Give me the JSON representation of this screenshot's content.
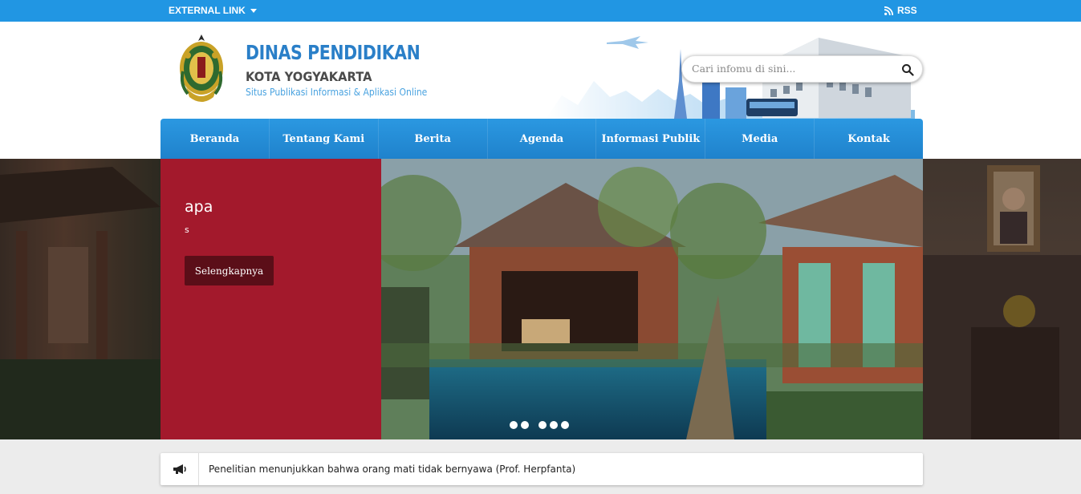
{
  "topbar": {
    "external_link_label": "EXTERNAL LINK",
    "rss_label": "RSS",
    "color": "#2196e3"
  },
  "brand": {
    "title": "DINAS PENDIDIKAN",
    "subtitle": "KOTA YOGYAKARTA",
    "tagline": "Situs Publikasi Informasi & Aplikasi Online"
  },
  "search": {
    "placeholder": "Cari infomu di sini..."
  },
  "nav": {
    "items": [
      {
        "label": "Beranda"
      },
      {
        "label": "Tentang Kami"
      },
      {
        "label": "Berita"
      },
      {
        "label": "Agenda"
      },
      {
        "label": "Informasi Publik"
      },
      {
        "label": "Media"
      },
      {
        "label": "Kontak"
      }
    ],
    "color": "#2b98e1"
  },
  "slider": {
    "caption_title": "apa",
    "caption_text": "s",
    "button_label": "Selengkapnya",
    "panel_color": "#a3192c",
    "dot_count": 5
  },
  "ticker": {
    "text": "Penelitian menunjukkan bahwa orang mati tidak bernyawa (Prof. Herpfanta)",
    "icon": "megaphone-icon"
  }
}
